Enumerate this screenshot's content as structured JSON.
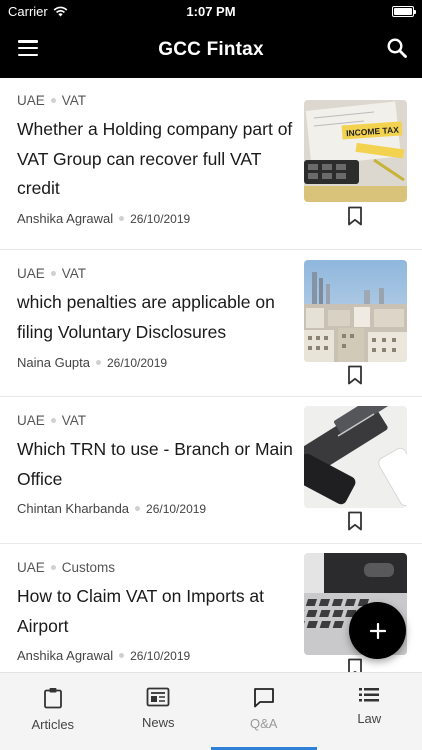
{
  "status_bar": {
    "carrier": "Carrier",
    "time": "1:07 PM"
  },
  "app_bar": {
    "title": "GCC Fintax"
  },
  "articles": [
    {
      "country": "UAE",
      "category": "VAT",
      "title": "Whether a Holding company part of VAT Group can recover full VAT credit",
      "author": "Anshika Agrawal",
      "date": "26/10/2019",
      "image_text": "INCOME TAX"
    },
    {
      "country": "UAE",
      "category": "VAT",
      "title": "which penalties are applicable on filing Voluntary Disclosures",
      "author": "Naina Gupta",
      "date": "26/10/2019"
    },
    {
      "country": "UAE",
      "category": "VAT",
      "title": "Which TRN to use - Branch or Main Office",
      "author": "Chintan Kharbanda",
      "date": "26/10/2019"
    },
    {
      "country": "UAE",
      "category": "Customs",
      "title": "How to Claim VAT on Imports at Airport",
      "author": "Anshika Agrawal",
      "date": "26/10/2019"
    }
  ],
  "tabs": [
    {
      "label": "Articles",
      "icon": "clipboard-icon"
    },
    {
      "label": "News",
      "icon": "newspaper-icon"
    },
    {
      "label": "Q&A",
      "icon": "chat-icon",
      "active": true
    },
    {
      "label": "Law",
      "icon": "list-icon"
    }
  ],
  "colors": {
    "header": "#000000",
    "active_tab_indicator": "#2f80d8",
    "fab": "#000000"
  }
}
